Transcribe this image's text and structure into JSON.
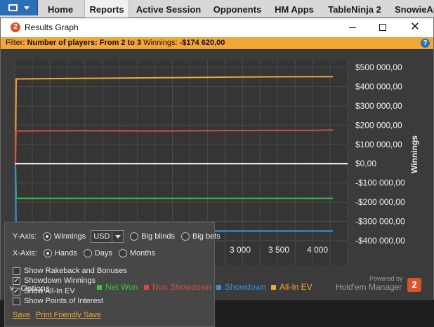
{
  "nav": {
    "tabs": [
      {
        "label": "Home",
        "active": false
      },
      {
        "label": "Reports",
        "active": true
      },
      {
        "label": "Active Session",
        "active": false
      },
      {
        "label": "Opponents",
        "active": false
      },
      {
        "label": "HM Apps",
        "active": false
      },
      {
        "label": "TableNinja 2",
        "active": false
      },
      {
        "label": "SnowieAp",
        "active": false
      }
    ]
  },
  "window": {
    "title": "Results Graph",
    "logo_glyph": "2",
    "minimize_icon": "minimize-icon",
    "maximize_icon": "maximize-icon",
    "close_glyph": "✕"
  },
  "filter": {
    "prefix": "Filter:",
    "condition": "Number of players: From 2 to 3",
    "winnings_label": "Winnings:",
    "winnings_value": "-$174 620,00",
    "help_glyph": "?"
  },
  "chart_data": {
    "type": "line",
    "ylabel": "Winnings",
    "y_ticks": [
      "$500 000,00",
      "$400 000,00",
      "$300 000,00",
      "$200 000,00",
      "$100 000,00",
      "$0,00",
      "-$100 000,00",
      "-$200 000,00",
      "-$300 000,00",
      "-$400 000,00"
    ],
    "ylim": [
      -440000,
      520000
    ],
    "x_ticks": [
      {
        "value": 3000,
        "label": "3 000"
      },
      {
        "value": 3500,
        "label": "3 500"
      },
      {
        "value": 4000,
        "label": "4 000"
      }
    ],
    "xlim": [
      0,
      4200
    ],
    "grid": true,
    "series": [
      {
        "name": "All-In EV",
        "color": "#f4a634",
        "points": [
          [
            0,
            0
          ],
          [
            15,
            440000
          ],
          [
            1000,
            443000
          ],
          [
            2000,
            446000
          ],
          [
            3000,
            450000
          ],
          [
            4000,
            452000
          ],
          [
            4200,
            452000
          ]
        ]
      },
      {
        "name": "Non Showdown",
        "color": "#d44a4a",
        "points": [
          [
            0,
            0
          ],
          [
            15,
            170000
          ],
          [
            1000,
            171000
          ],
          [
            2000,
            170000
          ],
          [
            3000,
            172000
          ],
          [
            4000,
            173000
          ],
          [
            4200,
            175000
          ]
        ]
      },
      {
        "name": "Net Won",
        "color": "#39c43a",
        "points": [
          [
            0,
            0
          ],
          [
            15,
            -180000
          ],
          [
            4200,
            -180000
          ]
        ]
      },
      {
        "name": "Showdown",
        "color": "#3a8fd8",
        "points": [
          [
            0,
            0
          ],
          [
            15,
            -350000
          ],
          [
            4200,
            -350000
          ]
        ]
      }
    ],
    "zero_line": {
      "color": "#ffffff"
    }
  },
  "options_panel": {
    "yaxis_label": "Y-Axis:",
    "winnings_option": "Winnings",
    "currency": "USD",
    "bigblinds_option": "Big blinds",
    "bigbets_option": "Big bets",
    "xaxis_label": "X-Axis:",
    "hands_option": "Hands",
    "days_option": "Days",
    "months_option": "Months",
    "checkboxes": [
      {
        "label": "Show Rakeback and Bonuses",
        "checked": false
      },
      {
        "label": "Showdown Winnings",
        "checked": true
      },
      {
        "label": "Show All-In EV",
        "checked": true
      },
      {
        "label": "Show Points of Interest",
        "checked": false
      }
    ],
    "save_link": "Save",
    "print_link": "Print Friendly Save",
    "check_glyph": "✓"
  },
  "bottom": {
    "options_button": "Options",
    "chevron": "˅",
    "legend": [
      {
        "label": "Net Won",
        "color": "#39c43a"
      },
      {
        "label": "Non Showdown",
        "color": "#d44a4a"
      },
      {
        "label": "Showdown",
        "color": "#3a8fd8"
      },
      {
        "label": "All-In EV",
        "color": "#f4a634"
      }
    ],
    "powered_by": "Powered by",
    "brand": "Hold'em Manager",
    "brand_glyph": "2"
  }
}
